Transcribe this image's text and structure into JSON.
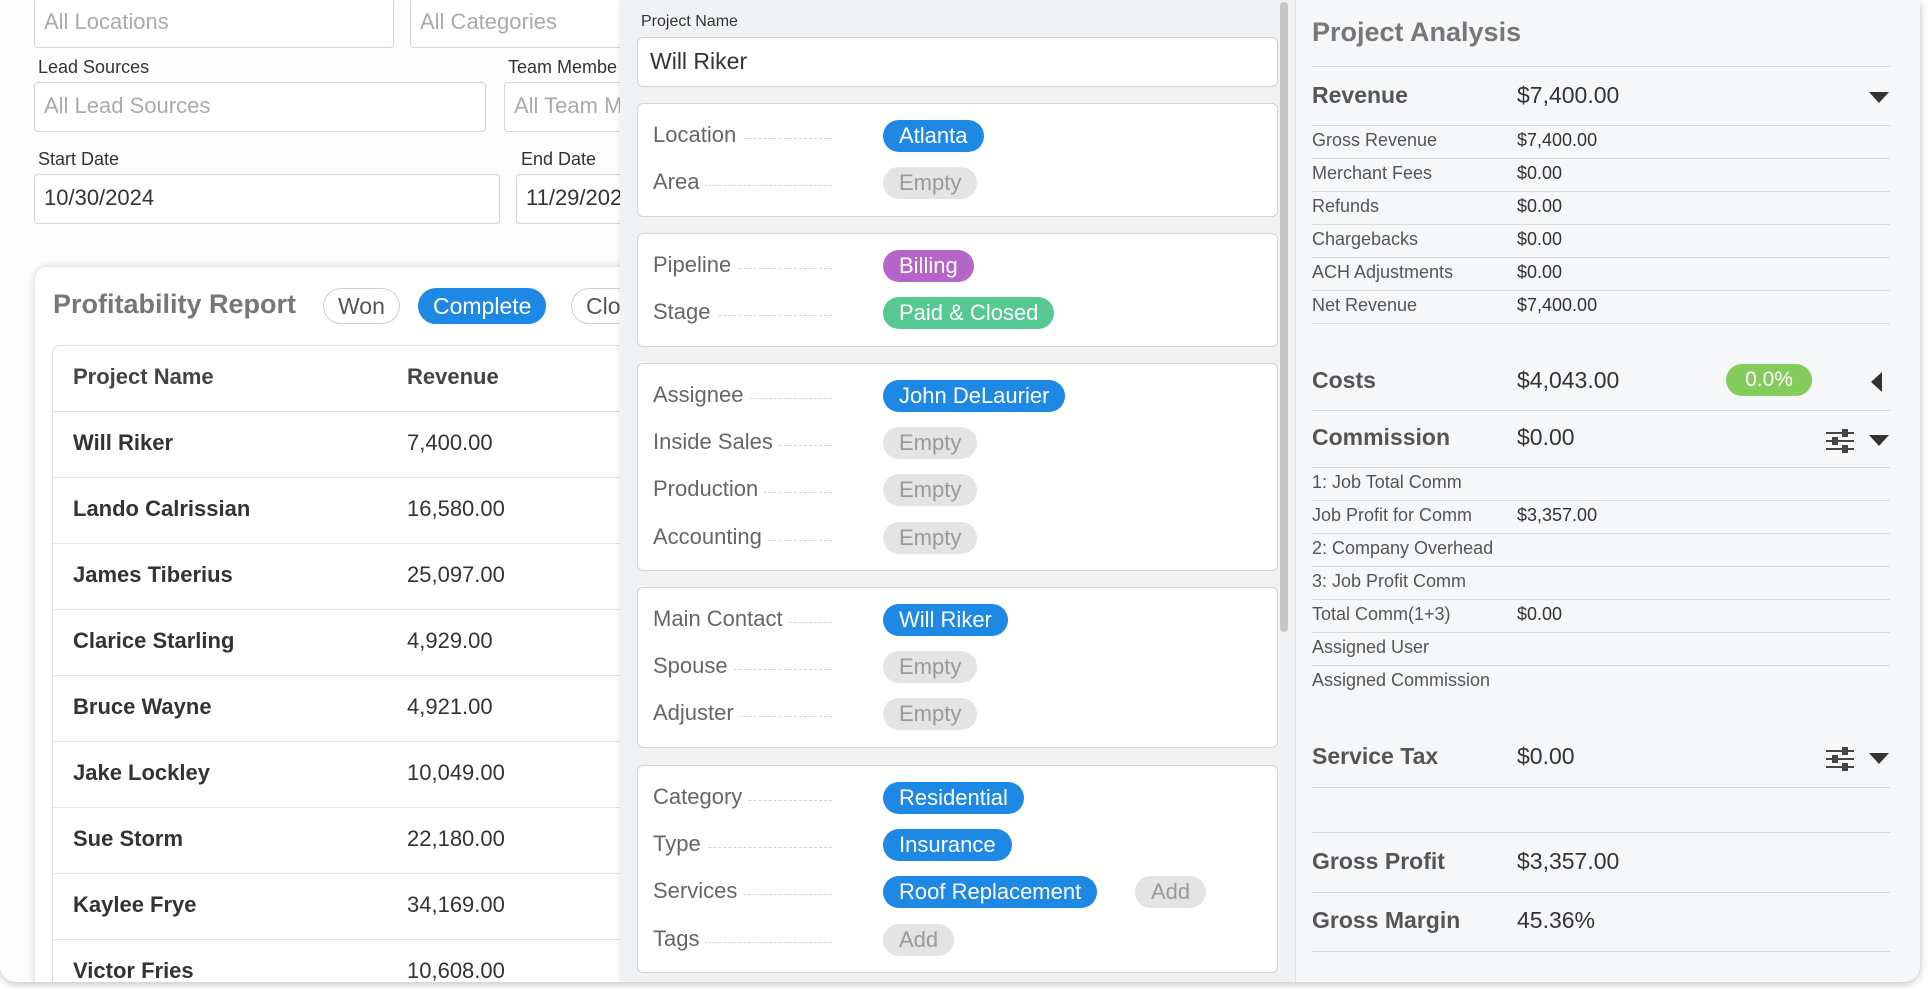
{
  "filters": {
    "locations_placeholder": "All Locations",
    "categories_placeholder": "All Categories",
    "lead_sources_label": "Lead Sources",
    "lead_sources_placeholder": "All Lead Sources",
    "team_members_label": "Team Membe",
    "team_members_placeholder": "All Team M",
    "start_date_label": "Start Date",
    "start_date_value": "10/30/2024",
    "end_date_label": "End Date",
    "end_date_value": "11/29/202"
  },
  "report": {
    "title": "Profitability Report",
    "chips": [
      "Won",
      "Complete",
      "Clo"
    ],
    "active_chip": "Complete",
    "columns": [
      "Project Name",
      "Revenue"
    ],
    "rows": [
      {
        "name": "Will Riker",
        "revenue": "7,400.00"
      },
      {
        "name": "Lando Calrissian",
        "revenue": "16,580.00"
      },
      {
        "name": "James Tiberius",
        "revenue": "25,097.00"
      },
      {
        "name": "Clarice Starling",
        "revenue": "4,929.00"
      },
      {
        "name": "Bruce Wayne",
        "revenue": "4,921.00"
      },
      {
        "name": "Jake Lockley",
        "revenue": "10,049.00"
      },
      {
        "name": "Sue Storm",
        "revenue": "22,180.00"
      },
      {
        "name": "Kaylee Frye",
        "revenue": "34,169.00"
      },
      {
        "name": "Victor Fries",
        "revenue": "10,608.00"
      }
    ]
  },
  "detail": {
    "project_name_label": "Project Name",
    "project_name_value": "Will Riker",
    "location_label": "Location",
    "location_value": "Atlanta",
    "area_label": "Area",
    "area_value": "Empty",
    "pipeline_label": "Pipeline",
    "pipeline_value": "Billing",
    "stage_label": "Stage",
    "stage_value": "Paid & Closed",
    "assignee_label": "Assignee",
    "assignee_value": "John DeLaurier",
    "inside_sales_label": "Inside Sales",
    "inside_sales_value": "Empty",
    "production_label": "Production",
    "production_value": "Empty",
    "accounting_label": "Accounting",
    "accounting_value": "Empty",
    "main_contact_label": "Main Contact",
    "main_contact_value": "Will Riker",
    "spouse_label": "Spouse",
    "spouse_value": "Empty",
    "adjuster_label": "Adjuster",
    "adjuster_value": "Empty",
    "category_label": "Category",
    "category_value": "Residential",
    "type_label": "Type",
    "type_value": "Insurance",
    "services_label": "Services",
    "services_value": "Roof Replacement",
    "services_add": "Add",
    "tags_label": "Tags",
    "tags_add": "Add"
  },
  "analysis": {
    "title": "Project Analysis",
    "revenue": {
      "label": "Revenue",
      "value": "$7,400.00"
    },
    "revenue_items": [
      {
        "label": "Gross Revenue",
        "value": "$7,400.00"
      },
      {
        "label": "Merchant Fees",
        "value": "$0.00"
      },
      {
        "label": "Refunds",
        "value": "$0.00"
      },
      {
        "label": "Chargebacks",
        "value": "$0.00"
      },
      {
        "label": "ACH Adjustments",
        "value": "$0.00"
      },
      {
        "label": "Net Revenue",
        "value": "$7,400.00"
      }
    ],
    "costs": {
      "label": "Costs",
      "value": "$4,043.00",
      "percent": "0.0%"
    },
    "commission": {
      "label": "Commission",
      "value": "$0.00"
    },
    "commission_items": [
      {
        "label": "1: Job Total Comm",
        "value": ""
      },
      {
        "label": "Job Profit for Comm",
        "value": "$3,357.00"
      },
      {
        "label": "2: Company Overhead",
        "value": ""
      },
      {
        "label": "3: Job Profit Comm",
        "value": ""
      },
      {
        "label": "Total Comm(1+3)",
        "value": "$0.00"
      },
      {
        "label": "Assigned User",
        "value": ""
      },
      {
        "label": "Assigned Commission",
        "value": ""
      }
    ],
    "service_tax": {
      "label": "Service Tax",
      "value": "$0.00"
    },
    "gross_profit": {
      "label": "Gross Profit",
      "value": "$3,357.00"
    },
    "gross_margin": {
      "label": "Gross Margin",
      "value": "45.36%"
    }
  },
  "colors": {
    "primary_blue": "#1e88e5",
    "purple_tag": "#b565c9",
    "green_tag": "#56c993",
    "percent_badge": "#84cc5b",
    "empty_tag": "#e4e4e4"
  }
}
